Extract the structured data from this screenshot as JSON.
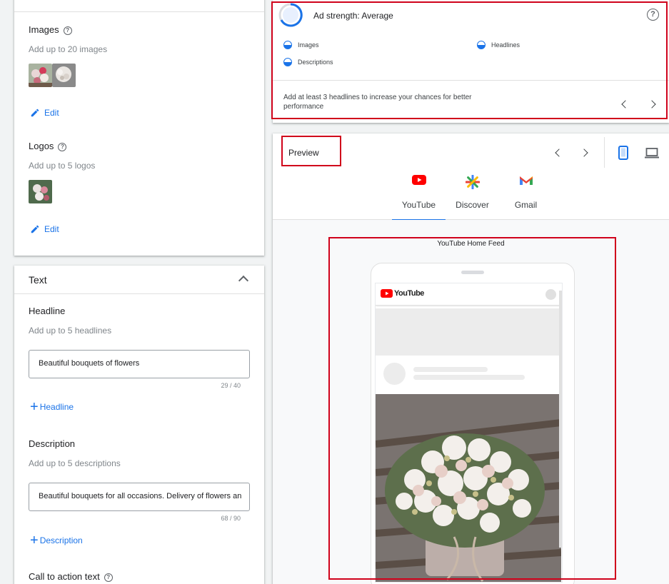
{
  "media": {
    "images_label": "Images",
    "images_hint": "Add up to 20 images",
    "images_edit": "Edit",
    "logos_label": "Logos",
    "logos_hint": "Add up to 5 logos",
    "logos_edit": "Edit"
  },
  "text_section": {
    "title": "Text",
    "headline_label": "Headline",
    "headline_hint": "Add up to 5 headlines",
    "headline_value": "Beautiful bouquets of flowers",
    "headline_counter": "29 / 40",
    "add_headline": "Headline",
    "description_label": "Description",
    "description_hint": "Add up to 5 descriptions",
    "description_value": "Beautiful bouquets for all occasions. Delivery of flowers an",
    "description_counter": "68 / 90",
    "add_description": "Description",
    "cta_label": "Call to action text"
  },
  "ad_strength": {
    "title": "Ad strength: Average",
    "metrics": [
      "Images",
      "Headlines",
      "Descriptions"
    ],
    "tip": "Add at least 3 headlines to increase your chances for better performance"
  },
  "preview": {
    "title": "Preview",
    "tabs": [
      {
        "label": "YouTube",
        "icon": "youtube-icon"
      },
      {
        "label": "Discover",
        "icon": "discover-icon"
      },
      {
        "label": "Gmail",
        "icon": "gmail-icon"
      }
    ],
    "active_tab": "YouTube",
    "feed_title": "YouTube Home Feed",
    "youtube_logo_text": "YouTube"
  },
  "colors": {
    "accent": "#1a73e8",
    "annotation_red": "#d0021b"
  }
}
